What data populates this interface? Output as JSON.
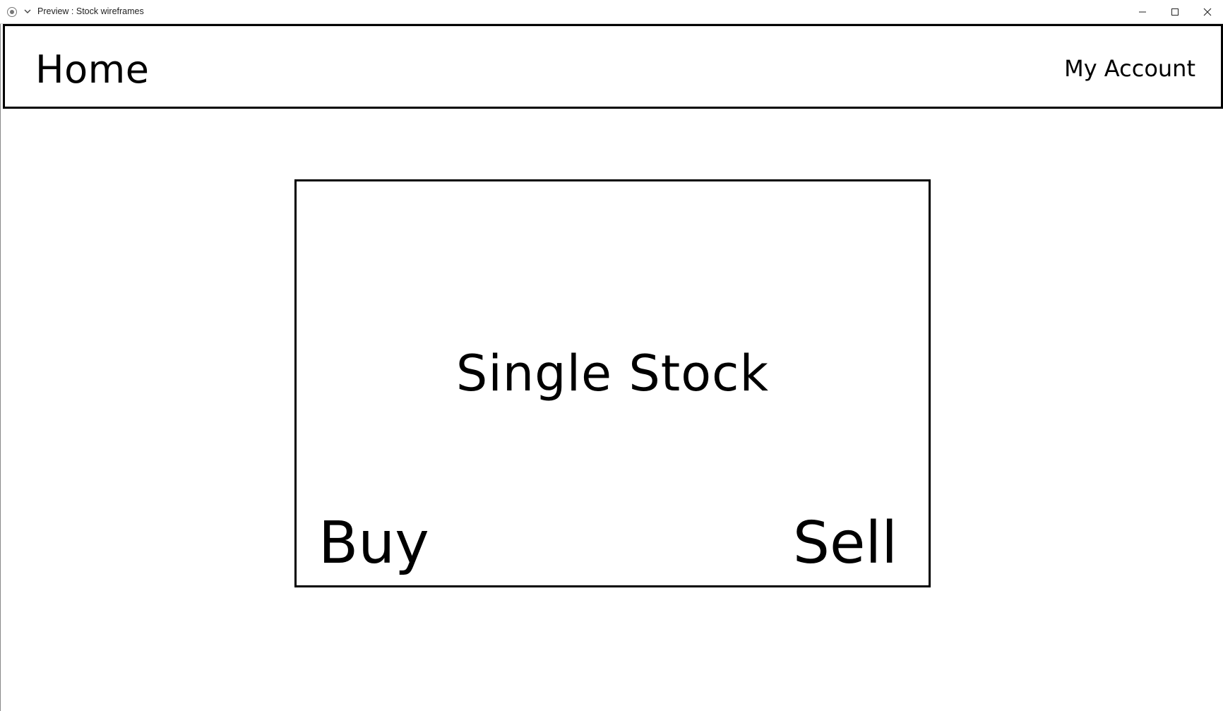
{
  "window": {
    "title": "Preview : Stock wireframes",
    "controls": {
      "minimize": "minimize-icon",
      "maximize": "maximize-icon",
      "close": "close-icon"
    }
  },
  "header": {
    "home_label": "Home",
    "account_label": "My Account"
  },
  "stock_card": {
    "title": "Single Stock",
    "buy_label": "Buy",
    "sell_label": "Sell"
  }
}
